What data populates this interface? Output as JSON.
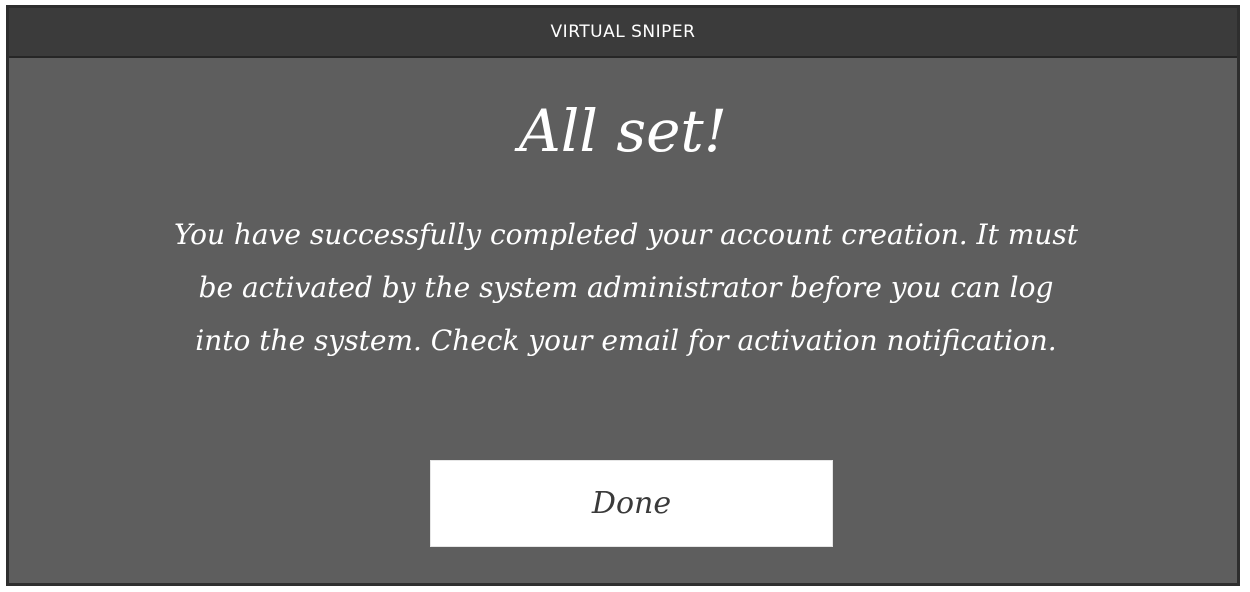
{
  "window": {
    "title": "VIRTUAL SNIPER"
  },
  "dialog": {
    "heading": "All set!",
    "message": "You have successfully completed your account creation. It must be activated by the system administrator before you can log into the system. Check your email for activation notification.",
    "done_label": "Done"
  },
  "colors": {
    "panel_background": "#5e5e5e",
    "titlebar_background": "#3b3b3b",
    "button_background": "#ffffff",
    "text": "#ffffff"
  }
}
